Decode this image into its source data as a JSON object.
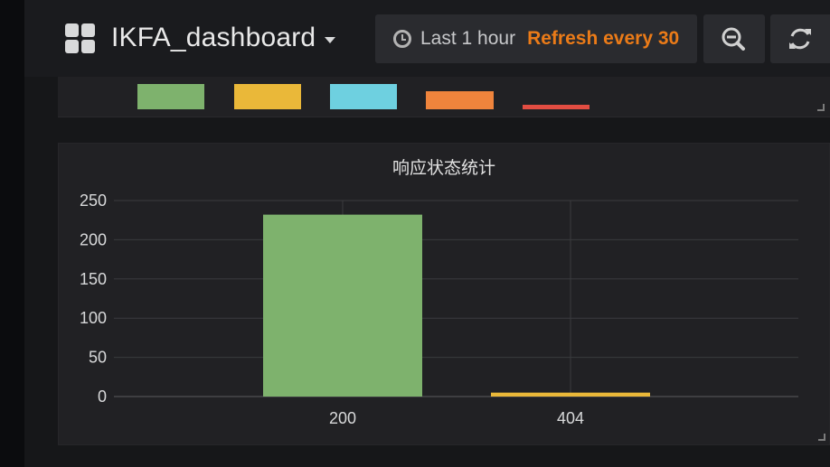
{
  "header": {
    "dashboard_title": "IKFA_dashboard",
    "time_range": "Last 1 hour",
    "refresh_label": "Refresh every 30",
    "icons": {
      "dashboard": "grid-icon",
      "time": "clock-icon",
      "zoom": "zoom-out-icon",
      "refresh": "refresh-icon"
    }
  },
  "legend_colors": [
    "#7eb26d",
    "#eab839",
    "#6ed0e0",
    "#ef843c",
    "#e24d42"
  ],
  "panel": {
    "title": "响应状态统计"
  },
  "chart_data": {
    "type": "bar",
    "title": "响应状态统计",
    "categories": [
      "200",
      "404"
    ],
    "values": [
      232,
      5
    ],
    "colors": [
      "#7eb26d",
      "#eab839"
    ],
    "y_ticks": [
      "0",
      "50",
      "100",
      "150",
      "200",
      "250"
    ],
    "ylim": [
      0,
      250
    ],
    "grid": true,
    "legend": "none"
  }
}
